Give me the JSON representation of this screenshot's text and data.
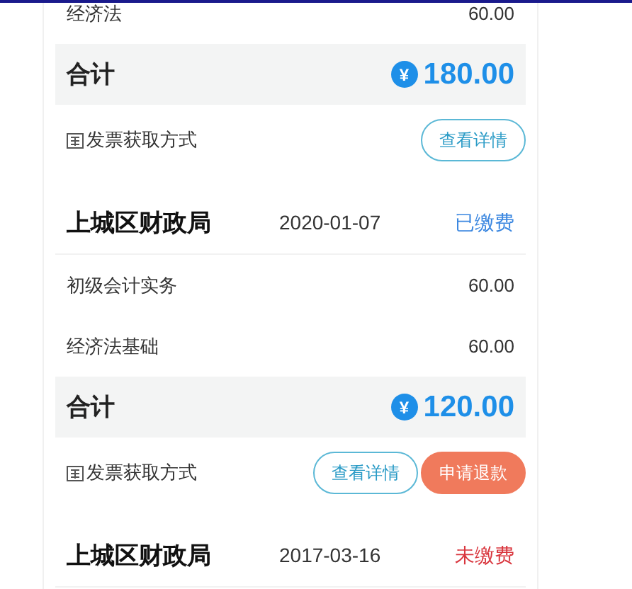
{
  "orders": [
    {
      "items": [
        {
          "name": "经济法",
          "amount": "60.00"
        }
      ],
      "total_label": "合计",
      "currency": "¥",
      "total": "180.00",
      "invoice_label": "发票获取方式",
      "buttons": [
        {
          "label": "查看详情",
          "kind": "outline"
        }
      ]
    },
    {
      "agency": "上城区财政局",
      "date": "2020-01-07",
      "status": "已缴费",
      "paid": true,
      "items": [
        {
          "name": "初级会计实务",
          "amount": "60.00"
        },
        {
          "name": "经济法基础",
          "amount": "60.00"
        }
      ],
      "total_label": "合计",
      "currency": "¥",
      "total": "120.00",
      "invoice_label": "发票获取方式",
      "buttons": [
        {
          "label": "查看详情",
          "kind": "outline"
        },
        {
          "label": "申请退款",
          "kind": "filled"
        }
      ]
    },
    {
      "agency": "上城区财政局",
      "date": "2017-03-16",
      "status": "未缴费",
      "paid": false
    }
  ]
}
